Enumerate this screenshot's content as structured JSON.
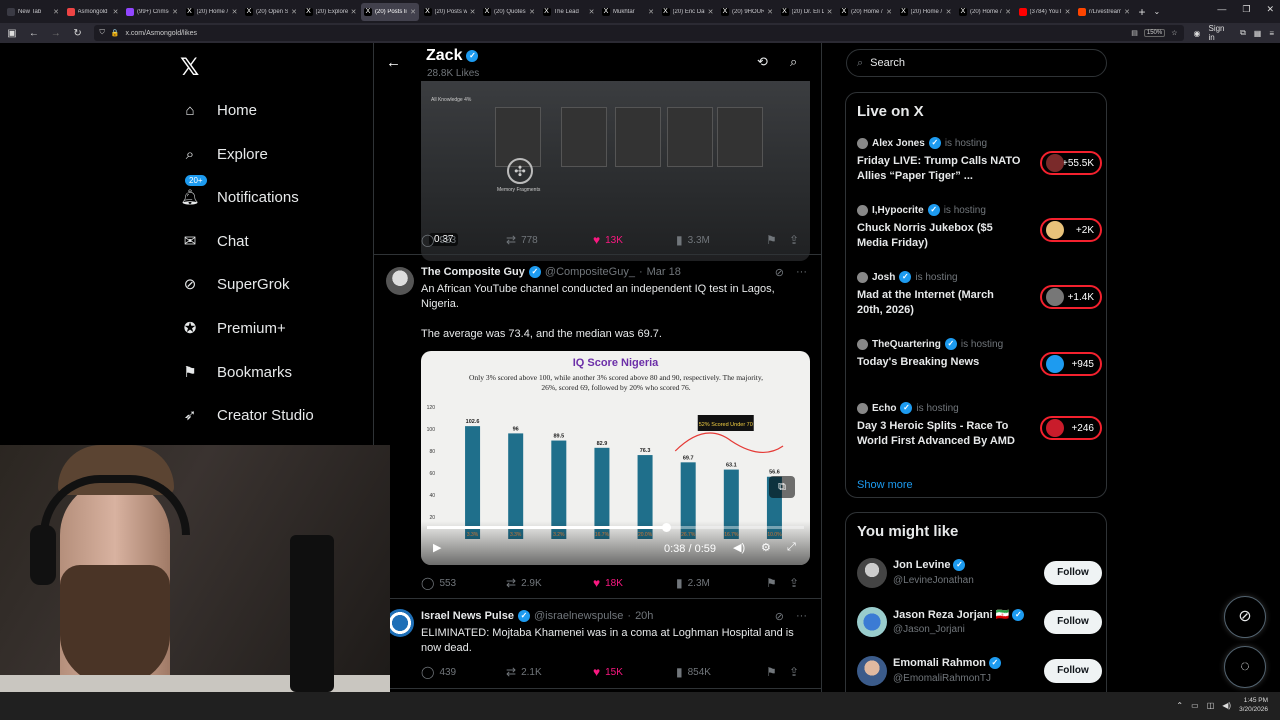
{
  "browser": {
    "tabs": [
      {
        "label": "New Tab",
        "color": "#3a3a44",
        "glyph": "",
        "active": false
      },
      {
        "label": "Asmongold",
        "color": "#e44",
        "glyph": "",
        "active": false
      },
      {
        "label": "(99+) Crimson",
        "color": "#9146ff",
        "glyph": "",
        "active": false
      },
      {
        "label": "(20) Home / X",
        "color": "#000",
        "glyph": "X",
        "active": false
      },
      {
        "label": "(20) Open Sou",
        "color": "#000",
        "glyph": "X",
        "active": false
      },
      {
        "label": "(20) Explore /",
        "color": "#000",
        "glyph": "X",
        "active": false
      },
      {
        "label": "(20) Posts li",
        "color": "#000",
        "glyph": "X",
        "active": true
      },
      {
        "label": "(20) Posts with",
        "color": "#000",
        "glyph": "X",
        "active": false
      },
      {
        "label": "(20) Quotes of",
        "color": "#000",
        "glyph": "X",
        "active": false
      },
      {
        "label": "The Lead",
        "color": "#000",
        "glyph": "X",
        "active": false
      },
      {
        "label": "Mukhtar",
        "color": "#000",
        "glyph": "X",
        "active": false
      },
      {
        "label": "(20) Eric Daug",
        "color": "#000",
        "glyph": "X",
        "active": false
      },
      {
        "label": "(20) 9HOUR",
        "color": "#000",
        "glyph": "X",
        "active": false
      },
      {
        "label": "(20) Dr. Eli Da",
        "color": "#000",
        "glyph": "X",
        "active": false
      },
      {
        "label": "(20) Home / X",
        "color": "#000",
        "glyph": "X",
        "active": false
      },
      {
        "label": "(20) Home / X",
        "color": "#000",
        "glyph": "X",
        "active": false
      },
      {
        "label": "(20) Home / X",
        "color": "#000",
        "glyph": "X",
        "active": false
      },
      {
        "label": "(3784) YouTub",
        "color": "#f00",
        "glyph": "",
        "active": false
      },
      {
        "label": "r/Livestreamf",
        "color": "#ff4500",
        "glyph": "",
        "active": false
      }
    ],
    "url": "x.com/Asmongold/likes",
    "zoom": "150%",
    "sign_in": "Sign in"
  },
  "nav": {
    "items": [
      {
        "label": "Home",
        "icon": "home-icon"
      },
      {
        "label": "Explore",
        "icon": "search-icon"
      },
      {
        "label": "Notifications",
        "icon": "bell-icon",
        "badge": "20+"
      },
      {
        "label": "Chat",
        "icon": "mail-icon"
      },
      {
        "label": "SuperGrok",
        "icon": "grok-icon"
      },
      {
        "label": "Premium+",
        "icon": "verified-icon"
      },
      {
        "label": "Bookmarks",
        "icon": "bookmark-icon"
      },
      {
        "label": "Creator Studio",
        "icon": "rocket-icon"
      }
    ]
  },
  "profile": {
    "name": "Zack",
    "likes": "28.8K Likes"
  },
  "post1": {
    "duration": "0:37",
    "card_labels": [
      "All Knowledge 4%",
      "Memory Fragments"
    ],
    "replies": "923",
    "reposts": "778",
    "likes": "13K",
    "views": "3.3M"
  },
  "post2": {
    "name": "The Composite Guy",
    "handle": "@CompositeGuy_",
    "date": "Mar 18",
    "text1": "An African YouTube channel conducted an independent IQ test in Lagos, Nigeria.",
    "text2": "The average was 73.4, and the median was 69.7.",
    "video_time": "0:38 / 0:59",
    "replies": "553",
    "reposts": "2.9K",
    "likes": "18K",
    "views": "2.3M"
  },
  "chart_data": {
    "type": "bar",
    "title": "IQ Score Nigeria",
    "subtitle": "Only 3% scored above 100, while another 3% scored above 80 and 90, respectively. The majority, 26%, scored 69, followed by 20% who scored 76.",
    "categories": [
      "102.6",
      "96",
      "89.5",
      "82.9",
      "76.3",
      "69.7",
      "63.1",
      "56.6"
    ],
    "values": [
      102.6,
      96,
      89.5,
      82.9,
      76.3,
      69.7,
      63.1,
      56.6
    ],
    "percent_labels": [
      "3.3%",
      "3.3%",
      "3.2%",
      "16.7%",
      "20.0%",
      "26.7%",
      "16.7%",
      "10.0%"
    ],
    "yticks": [
      "120",
      "100",
      "80",
      "60",
      "40",
      "20"
    ],
    "ylim": [
      0,
      120
    ],
    "annotation": "52% Scored Under 70",
    "bar_color": "#1f6f8b",
    "grid": false
  },
  "post3": {
    "name": "Israel News Pulse",
    "handle": "@israelnewspulse",
    "date": "20h",
    "text": "ELIMINATED: Mojtaba Khamenei was in a coma at Loghman Hospital and is now dead.",
    "replies": "439",
    "reposts": "2.1K",
    "likes": "15K",
    "views": "854K"
  },
  "search": {
    "placeholder": "Search"
  },
  "live": {
    "title": "Live on X",
    "is_hosting": "is hosting",
    "items": [
      {
        "host": "Alex Jones",
        "title": "Friday LIVE: Trump Calls NATO Allies “Paper Tiger” ...",
        "count": "+55.5K"
      },
      {
        "host": "I,Hypocrite",
        "title": "Chuck Norris Jukebox ($5 Media Friday)",
        "count": "+2K"
      },
      {
        "host": "Josh",
        "title": "Mad at the Internet (March 20th, 2026)",
        "count": "+1.4K"
      },
      {
        "host": "TheQuartering",
        "title": "Today's Breaking News",
        "count": "+945"
      },
      {
        "host": "Echo",
        "title": "Day 3 Heroic Splits - Race To World First Advanced By AMD",
        "count": "+246"
      }
    ],
    "show_more": "Show more"
  },
  "suggest": {
    "title": "You might like",
    "follow": "Follow",
    "items": [
      {
        "name": "Jon Levine",
        "handle": "@LevineJonathan",
        "flag": ""
      },
      {
        "name": "Jason Reza Jorjani",
        "handle": "@Jason_Jorjani",
        "flag": "🇮🇷"
      },
      {
        "name": "Emomali Rahmon",
        "handle": "@EmomaliRahmonTJ",
        "flag": ""
      }
    ]
  },
  "taskbar": {
    "time": "1:45 PM",
    "date": "3/20/2026"
  },
  "colors": {
    "accent": "#1d9bf0",
    "like": "#f91880",
    "live": "#f4212e"
  }
}
